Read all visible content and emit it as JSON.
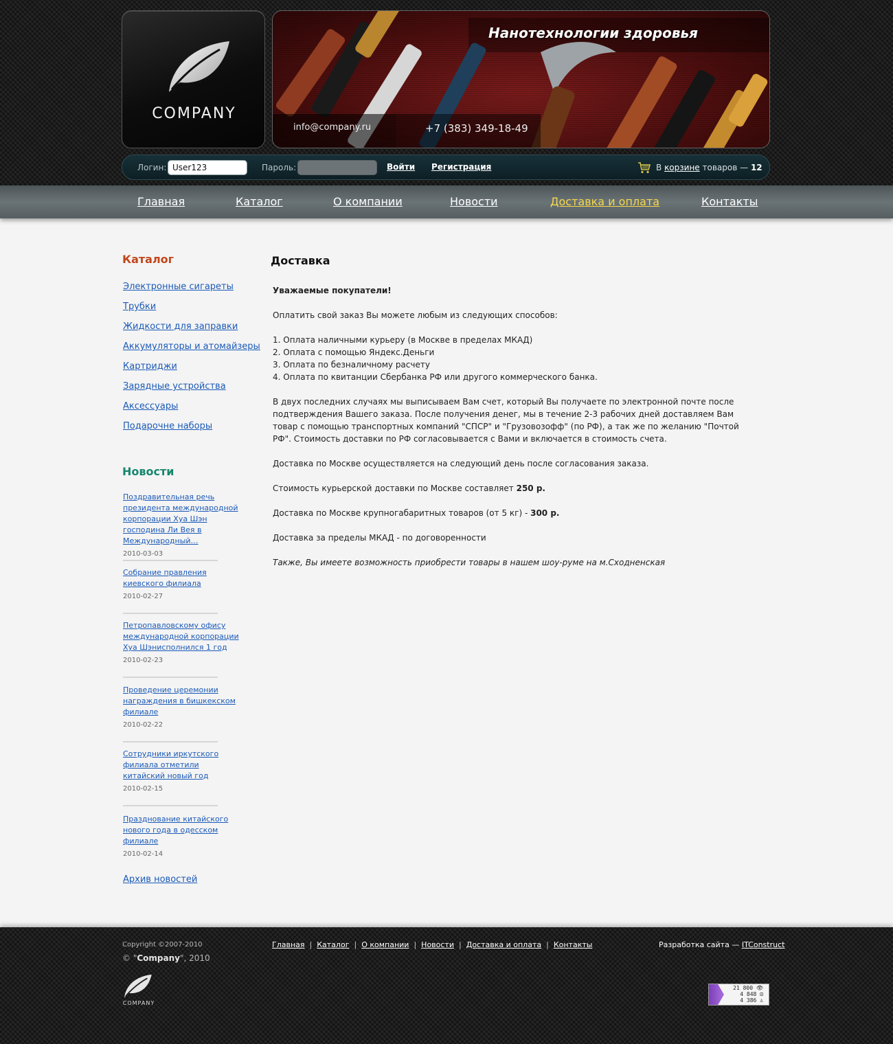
{
  "header": {
    "logo_text": "COMPANY",
    "slogan": "Нанотехнологии здоровья",
    "email": "info@company.ru",
    "phone": "+7 (383) 349-18-49"
  },
  "login": {
    "login_label": "Логин:",
    "login_value": "User123",
    "password_label": "Пароль:",
    "password_value": "",
    "enter_label": "Войти",
    "register_label": "Регистрация",
    "cart_prefix": "В",
    "cart_link": "корзине",
    "cart_suffix": "товаров —",
    "cart_count": "12"
  },
  "menu": [
    {
      "label": "Главная",
      "active": false
    },
    {
      "label": "Каталог",
      "active": false
    },
    {
      "label": "О компании",
      "active": false
    },
    {
      "label": "Новости",
      "active": false
    },
    {
      "label": "Доставка и оплата",
      "active": true
    },
    {
      "label": "Контакты",
      "active": false
    }
  ],
  "sidebar": {
    "catalog_title": "Каталог",
    "catalog_items": [
      "Электронные сигареты",
      "Трубки",
      "Жидкости для заправки",
      "Аккумуляторы и атомайзеры",
      "Картриджи",
      "Зарядные устройства",
      "Аксессуары",
      "Подарочне наборы"
    ],
    "news_title": "Новости",
    "news": [
      {
        "title": "Поздравительная речь президента международной корпорации Хуа Шэн господина Ли Вея в Международный…",
        "date": "2010-03-03"
      },
      {
        "title": "Собрание правления киевского филиала",
        "date": "2010-02-27"
      },
      {
        "title": "Петропавловскому офису международной корпорации Хуа Шэнисполнился 1 год",
        "date": "2010-02-23"
      },
      {
        "title": "Проведение церемонии награждения в бишкекском филиале",
        "date": "2010-02-22"
      },
      {
        "title": "Сотрудники иркутского филиала отметили китайский новый год",
        "date": "2010-02-15"
      },
      {
        "title": "Празднование китайского нового года в одесском филиале",
        "date": "2010-02-14"
      }
    ],
    "news_archive": "Архив новостей"
  },
  "content": {
    "title": "Доставка",
    "greeting": "Уважаемые покупатели!",
    "pay_intro": "Оплатить свой заказ Вы можете любым из следующих способов:",
    "pay_methods": [
      "1. Оплата наличными курьеру (в Москве в пределах МКАД)",
      "2. Оплата с помощью Яндекс.Деньги",
      "3. Оплата по безналичному расчету",
      "4. Оплата по квитанции Сбербанка РФ или другого коммерческого банка."
    ],
    "invoice_text": "В двух последних случаях мы выписываем Вам счет, который Вы получаете по электронной почте после подтверждения Вашего заказа. После получения денег, мы в течение 2-3 рабочих дней доставляем Вам товар с помощью транспортных компаний \"СПСР\" и \"Грузовозофф\" (по РФ), а так же по желанию \"Почтой РФ\". Стоимость доставки по РФ согласовывается с Вами и включается в стоимость счета.",
    "moscow_delivery": "Доставка по Москве осуществляется на следующий день после согласования заказа.",
    "courier_cost_text": "Стоимость курьерской доставки по Москве составляет",
    "courier_cost_value": "250 р.",
    "bulk_text": "Доставка по Москве крупногабаритных товаров (от 5 кг) -",
    "bulk_value": "300 р.",
    "outside_mkad": "Доставка за пределы МКАД - по договоренности",
    "showroom": "Также, Вы имеете возможность приобрести товары в нашем шоу-руме на м.Сходненская"
  },
  "footer": {
    "copyright_years": "Copyright ©2007-2010",
    "copyright_prefix": "© \"",
    "copyright_name": "Company",
    "copyright_suffix": "\", 2010",
    "logo_text": "COMPANY",
    "nav": [
      "Главная",
      "Каталог",
      "О компании",
      "Новости",
      "Доставка и оплата",
      "Контакты"
    ],
    "nav_sep": "|",
    "dev_label": "Разработка сайта —",
    "dev_link": "ITConstruct",
    "counter": [
      "21 800 👁",
      "4 848 ⊡",
      "4 386 ♙"
    ]
  },
  "colors": {
    "link": "#1b5ab8",
    "catalog_title": "#c2461a",
    "news_title": "#17866e",
    "menu_active": "#f5d84c"
  },
  "icons": [
    "leaf-logo-icon",
    "cart-icon",
    "counter-bars-icon"
  ]
}
